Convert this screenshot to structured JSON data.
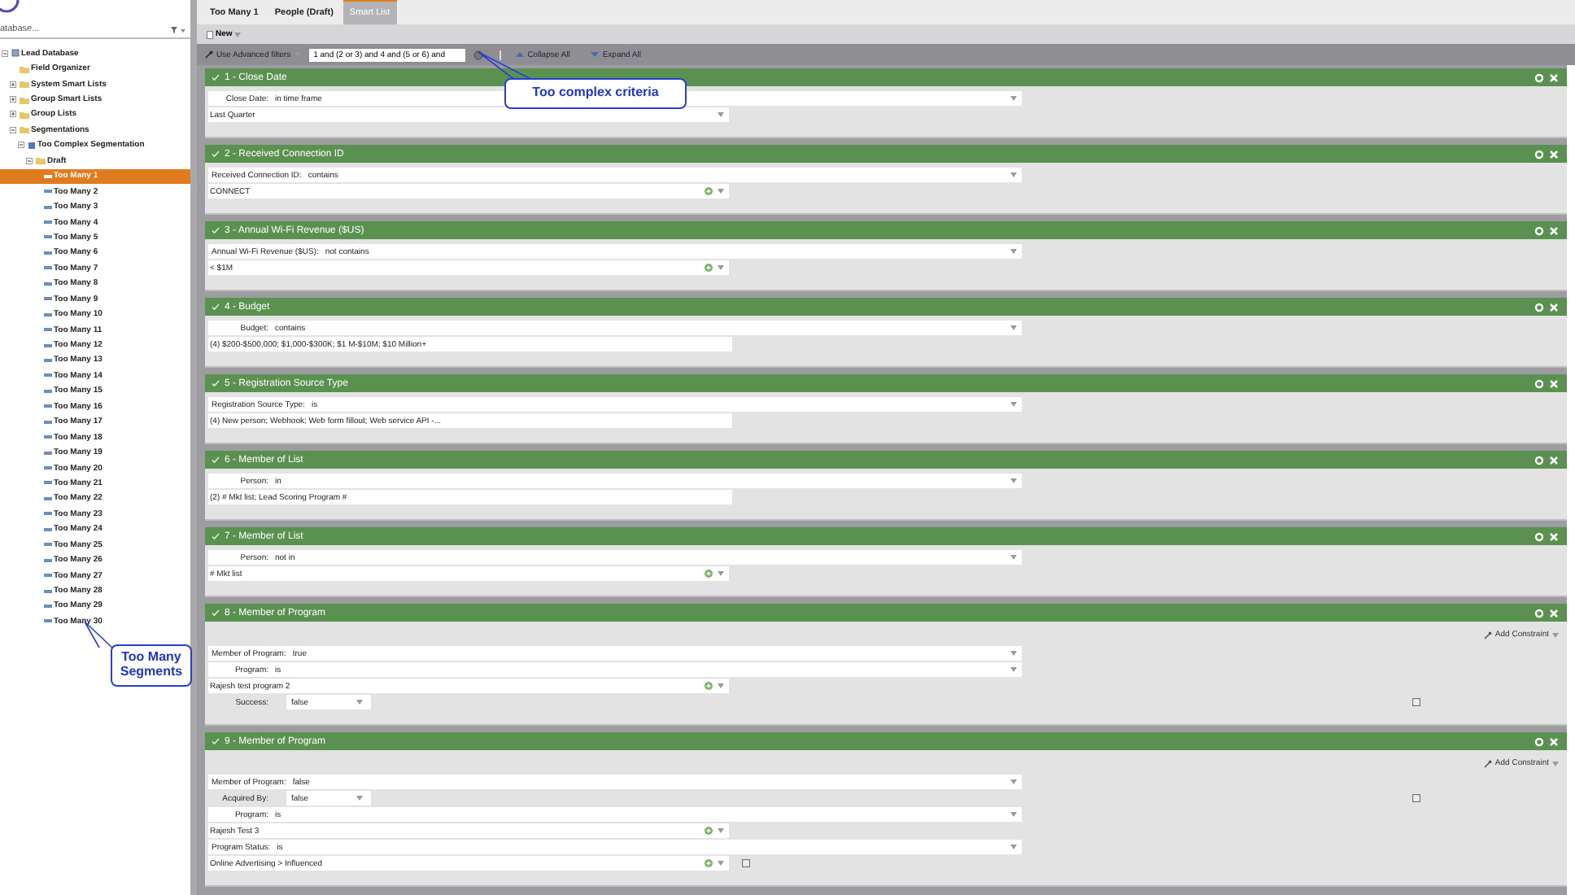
{
  "sidebar": {
    "search": {
      "placeholder": "atabase..."
    },
    "tree": [
      {
        "label": "Lead Database",
        "kind": "database",
        "expanded": true,
        "children": [
          {
            "label": "Field Organizer",
            "kind": "folder"
          },
          {
            "label": "System Smart Lists",
            "kind": "folder",
            "expanded": false
          },
          {
            "label": "Group Smart Lists",
            "kind": "folder",
            "expanded": false
          },
          {
            "label": "Group Lists",
            "kind": "folder",
            "expanded": false
          },
          {
            "label": "Segmentations",
            "kind": "folder",
            "expanded": true,
            "children": [
              {
                "label": "Too Complex Segmentation",
                "kind": "segmentation",
                "expanded": true,
                "children": [
                  {
                    "label": "Draft",
                    "kind": "folder",
                    "expanded": true,
                    "children": [
                      {
                        "label": "Too Many 1",
                        "kind": "segment",
                        "selected": true
                      },
                      {
                        "label": "Too Many 2",
                        "kind": "segment",
                        "selected": false
                      },
                      {
                        "label": "Too Many 3",
                        "kind": "segment",
                        "selected": false
                      },
                      {
                        "label": "Too Many 4",
                        "kind": "segment",
                        "selected": false
                      },
                      {
                        "label": "Too Many 5",
                        "kind": "segment",
                        "selected": false
                      },
                      {
                        "label": "Too Many 6",
                        "kind": "segment",
                        "selected": false
                      },
                      {
                        "label": "Too Many 7",
                        "kind": "segment",
                        "selected": false
                      },
                      {
                        "label": "Too Many 8",
                        "kind": "segment",
                        "selected": false
                      },
                      {
                        "label": "Too Many 9",
                        "kind": "segment",
                        "selected": false
                      },
                      {
                        "label": "Too Many 10",
                        "kind": "segment",
                        "selected": false
                      },
                      {
                        "label": "Too Many 11",
                        "kind": "segment",
                        "selected": false
                      },
                      {
                        "label": "Too Many 12",
                        "kind": "segment",
                        "selected": false
                      },
                      {
                        "label": "Too Many 13",
                        "kind": "segment",
                        "selected": false
                      },
                      {
                        "label": "Too Many 14",
                        "kind": "segment",
                        "selected": false
                      },
                      {
                        "label": "Too Many 15",
                        "kind": "segment",
                        "selected": false
                      },
                      {
                        "label": "Too Many 16",
                        "kind": "segment",
                        "selected": false
                      },
                      {
                        "label": "Too Many 17",
                        "kind": "segment",
                        "selected": false
                      },
                      {
                        "label": "Too Many 18",
                        "kind": "segment",
                        "selected": false
                      },
                      {
                        "label": "Too Many 19",
                        "kind": "segment",
                        "selected": false
                      },
                      {
                        "label": "Too Many 20",
                        "kind": "segment",
                        "selected": false
                      },
                      {
                        "label": "Too Many 21",
                        "kind": "segment",
                        "selected": false
                      },
                      {
                        "label": "Too Many 22",
                        "kind": "segment",
                        "selected": false
                      },
                      {
                        "label": "Too Many 23",
                        "kind": "segment",
                        "selected": false
                      },
                      {
                        "label": "Too Many 24",
                        "kind": "segment",
                        "selected": false
                      },
                      {
                        "label": "Too Many 25",
                        "kind": "segment",
                        "selected": false
                      },
                      {
                        "label": "Too Many 26",
                        "kind": "segment",
                        "selected": false
                      },
                      {
                        "label": "Too Many 27",
                        "kind": "segment",
                        "selected": false
                      },
                      {
                        "label": "Too Many 28",
                        "kind": "segment",
                        "selected": false
                      },
                      {
                        "label": "Too Many 29",
                        "kind": "segment",
                        "selected": false
                      },
                      {
                        "label": "Too Many 30",
                        "kind": "segment",
                        "selected": false
                      }
                    ]
                  }
                ]
              }
            ]
          }
        ]
      }
    ]
  },
  "tabs": [
    {
      "label": "Too Many 1",
      "selected": false
    },
    {
      "label": "People (Draft)",
      "selected": false
    },
    {
      "label": "Smart List",
      "selected": true
    }
  ],
  "toolbar": {
    "new_button": "New"
  },
  "filter_bar": {
    "advanced": "Use Advanced filters",
    "logic": "1 and (2 or 3) and 4 and (5 or 6) and",
    "collapse": "Collapse All",
    "expand": "Expand All"
  },
  "filters": [
    {
      "title": "1 - Close Date",
      "rows": [
        {
          "kind": "operator",
          "label": "Close Date:",
          "value": "in time frame"
        },
        {
          "kind": "picklist",
          "value": "Last Quarter"
        }
      ]
    },
    {
      "title": "2 - Received Connection ID",
      "rows": [
        {
          "kind": "operator",
          "label": "Received Connection ID:",
          "value": "contains"
        },
        {
          "kind": "list",
          "value": "CONNECT"
        }
      ]
    },
    {
      "title": "3 - Annual Wi-Fi Revenue ($US)",
      "rows": [
        {
          "kind": "operator",
          "label": "Annual Wi-Fi Revenue ($US):",
          "value": "not contains"
        },
        {
          "kind": "list",
          "value": "< $1M"
        }
      ]
    },
    {
      "title": "4 - Budget",
      "rows": [
        {
          "kind": "operator",
          "label": "Budget:",
          "value": "contains"
        },
        {
          "kind": "text",
          "value": "(4) $200-$500,000; $1,000-$300K; $1 M-$10M; $10 Million+"
        }
      ]
    },
    {
      "title": "5 - Registration Source Type",
      "rows": [
        {
          "kind": "operator",
          "label": "Registration Source Type:",
          "value": "is"
        },
        {
          "kind": "text",
          "value": "(4) New person; Webhook; Web form fillout; Web service API -..."
        }
      ]
    },
    {
      "title": "6 - Member of List",
      "rows": [
        {
          "kind": "operator",
          "label": "Person:",
          "value": "in"
        },
        {
          "kind": "text",
          "value": "(2) # Mkt list; Lead Scoring Program #"
        }
      ]
    },
    {
      "title": "7 - Member of List",
      "rows": [
        {
          "kind": "operator",
          "label": "Person:",
          "value": "not in"
        },
        {
          "kind": "list",
          "value": "# Mkt list"
        }
      ]
    },
    {
      "title": "8 - Member of Program",
      "add_constraint": "Add Constraint",
      "rows": [
        {
          "kind": "operator",
          "label": "Member of Program:",
          "value": "true"
        },
        {
          "kind": "operator",
          "label": "Program:",
          "value": "is"
        },
        {
          "kind": "list",
          "value": "Rajesh test program 2"
        },
        {
          "kind": "small",
          "label": "Success:",
          "value": "false",
          "checked": false
        }
      ]
    },
    {
      "title": "9 - Member of Program",
      "add_constraint": "Add Constraint",
      "rows": [
        {
          "kind": "operator",
          "label": "Member of Program:",
          "value": "false"
        },
        {
          "kind": "small",
          "label": "Acquired By:",
          "value": "false",
          "checked": false
        },
        {
          "kind": "operator",
          "label": "Program:",
          "value": "is"
        },
        {
          "kind": "list",
          "value": "Rajesh Test 3"
        },
        {
          "kind": "operator",
          "label": "Program Status:",
          "value": "is"
        },
        {
          "kind": "list",
          "value": "Online Advertising > Influenced",
          "checked": false
        }
      ]
    }
  ],
  "callouts": [
    {
      "text": "Too complex criteria"
    },
    {
      "text": "Too Many Segments"
    }
  ]
}
